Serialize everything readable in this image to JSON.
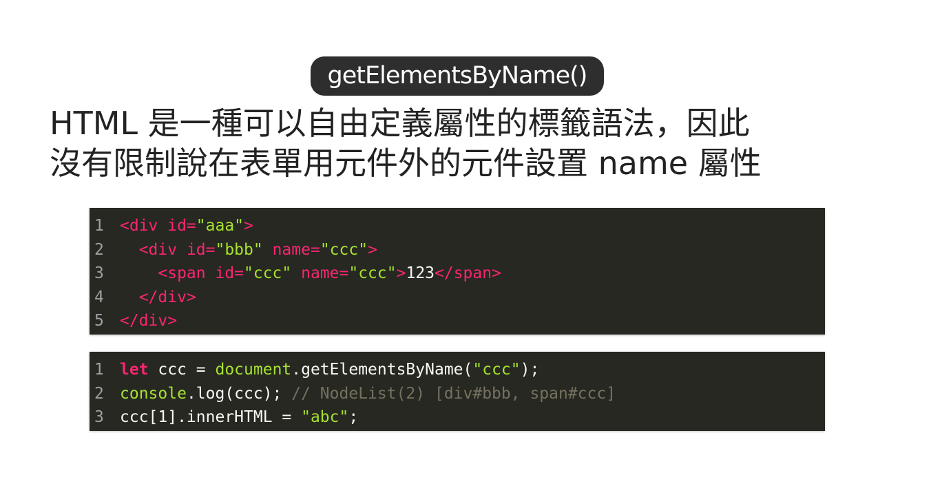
{
  "title": "getElementsByName()",
  "description": {
    "line1": "HTML 是一種可以自由定義屬性的標籤語法，因此",
    "line2": "沒有限制說在表單用元件外的元件設置 name 屬性"
  },
  "code1": {
    "line_numbers": [
      "1",
      "2",
      "3",
      "4",
      "5"
    ],
    "l1": {
      "t1": "<div id=",
      "s1": "\"aaa\"",
      "t2": ">"
    },
    "l2": {
      "indent": "  ",
      "t1": "<div id=",
      "s1": "\"bbb\"",
      "t2": " name=",
      "s2": "\"ccc\"",
      "t3": ">"
    },
    "l3": {
      "indent": "    ",
      "t1": "<span id=",
      "s1": "\"ccc\"",
      "t2": " name=",
      "s2": "\"ccc\"",
      "t3": ">",
      "text": "123",
      "t4": "</span>"
    },
    "l4": {
      "indent": "  ",
      "t1": "</div>"
    },
    "l5": {
      "t1": "</div>"
    }
  },
  "code2": {
    "line_numbers": [
      "1",
      "2",
      "3"
    ],
    "l1": {
      "kw": "let",
      "a": " ccc = ",
      "obj": "document",
      "b": ".getElementsByName(",
      "str": "\"ccc\"",
      "c": ");"
    },
    "l2": {
      "obj": "console",
      "a": ".log(ccc); ",
      "comment": "// NodeList(2) [div#bbb, span#ccc]"
    },
    "l3": {
      "a": "ccc[1].innerHTML = ",
      "str": "\"abc\"",
      "b": ";"
    }
  },
  "colors": {
    "code_background": "#272822",
    "tag": "#f92672",
    "string": "#a6e22e",
    "comment": "#75715e",
    "title_background": "#2e2e2e"
  }
}
